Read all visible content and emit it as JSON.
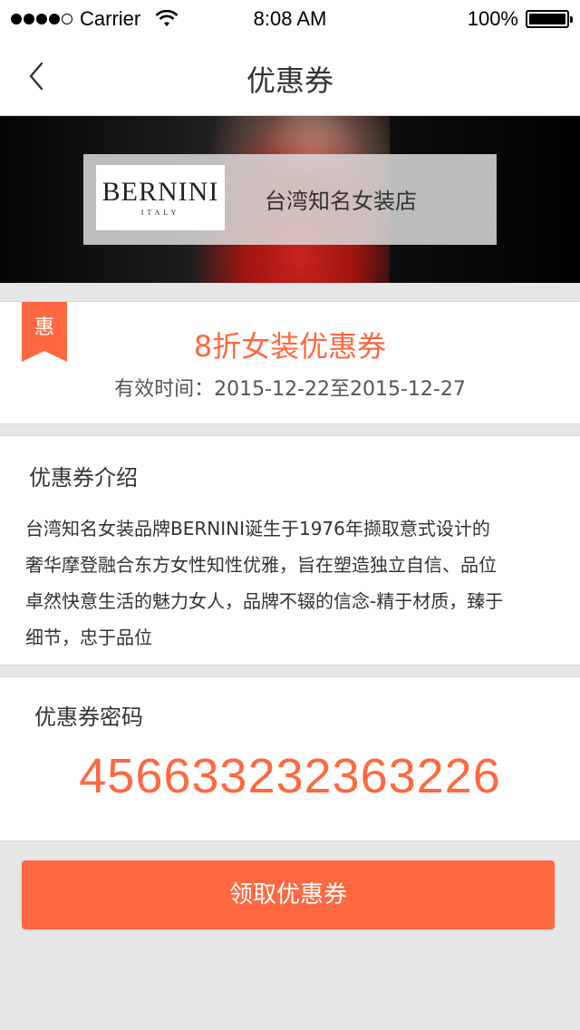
{
  "status_bar": {
    "carrier": "Carrier",
    "time": "8:08 AM",
    "battery": "100%"
  },
  "nav": {
    "title": "优惠券",
    "back_icon": "chevron-left-icon"
  },
  "banner": {
    "brand_name": "BERNINI",
    "brand_sub": "ITALY",
    "store_name": "台湾知名女装店"
  },
  "coupon": {
    "tag": "惠",
    "title": "8折女装优惠券",
    "validity": "有效时间：2015-12-22至2015-12-27"
  },
  "intro": {
    "heading": "优惠券介绍",
    "lines": [
      "台湾知名女装品牌BERNINI诞生于1976年撷取意式设计的",
      "奢华摩登融合东方女性知性优雅，旨在塑造独立自信、品位",
      "卓然快意生活的魅力女人，品牌不辍的信念-精于材质，臻于",
      "细节，忠于品位"
    ]
  },
  "password": {
    "heading": "优惠券密码",
    "value": "456633232363226"
  },
  "action": {
    "claim_label": "领取优惠券"
  },
  "colors": {
    "accent": "#ff6840",
    "background": "#e6e6e6"
  }
}
